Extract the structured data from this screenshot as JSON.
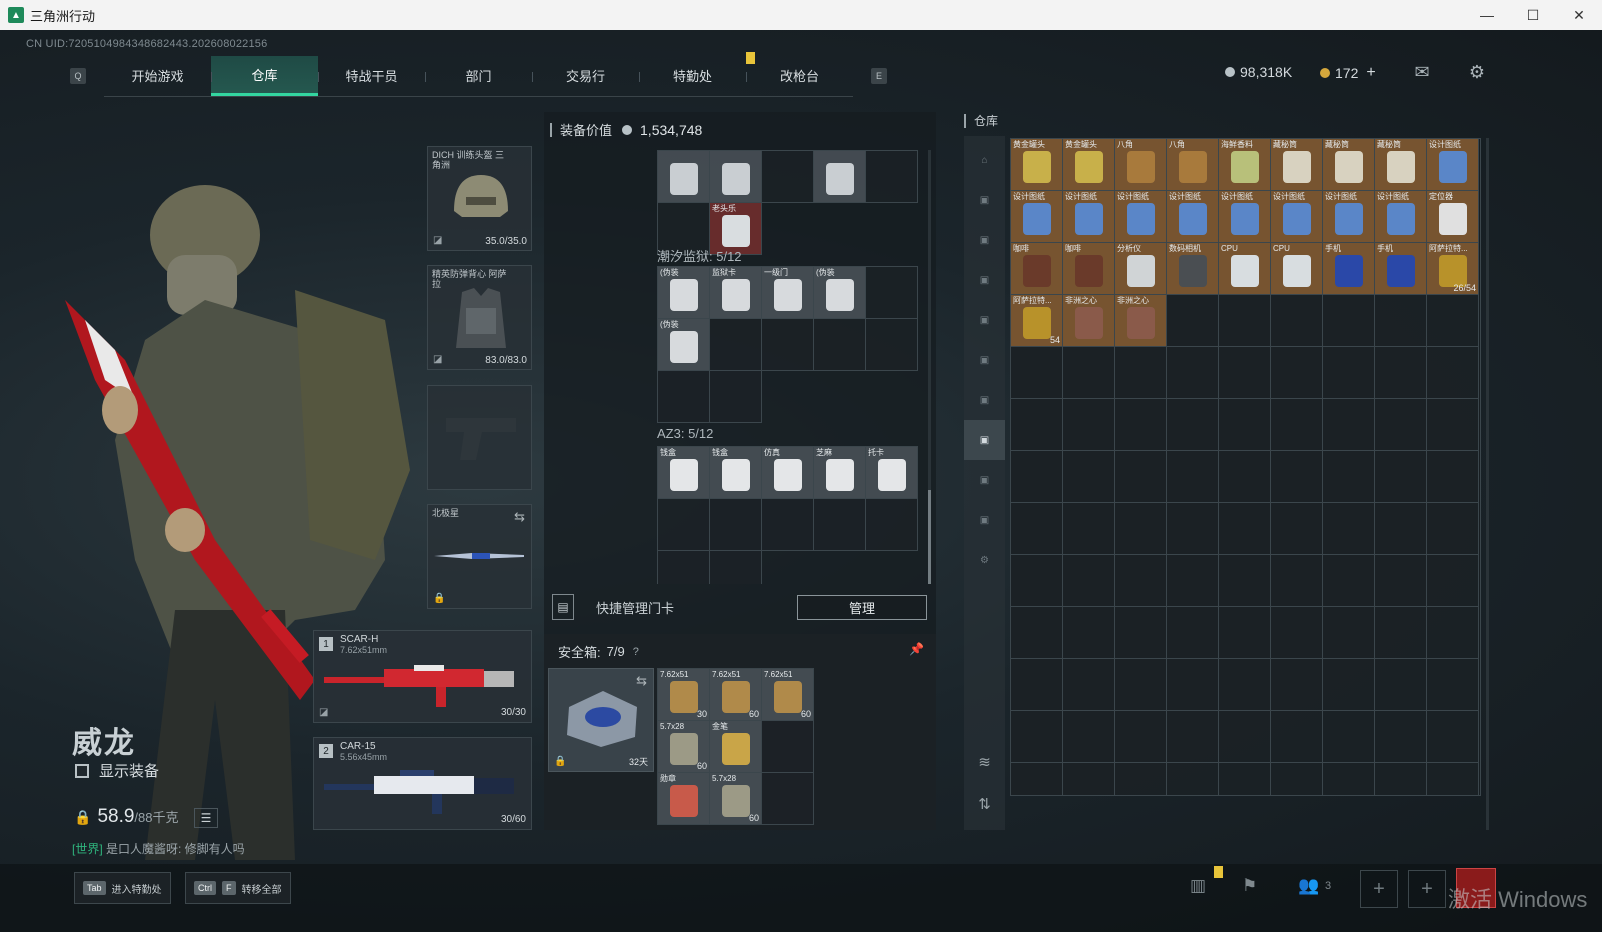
{
  "window": {
    "title": "三角洲行动",
    "minimize": "—",
    "maximize": "☐",
    "close": "✕"
  },
  "uid": "CN UID:7205104984348682443.202608022156",
  "nav": {
    "left_key": "Q",
    "right_key": "E",
    "tabs": [
      "开始游戏",
      "仓库",
      "特战干员",
      "部门",
      "交易行",
      "特勤处",
      "改枪台"
    ],
    "active_tab": "仓库"
  },
  "currency": {
    "money": "98,318K",
    "coins": "172",
    "add": "+"
  },
  "character": {
    "name": "威龙",
    "show_equipment": "显示装备",
    "weight_current": "58.9",
    "weight_max": "/88千克",
    "chat_channel": "[世界]",
    "chat_message": "是口人魔酱呀: 修脚有人吗"
  },
  "equipment": {
    "helmet": {
      "label": "DICH 训练头盔 三角洲",
      "durability": "35.0/35.0"
    },
    "armor": {
      "label": "精英防弹背心 阿萨拉",
      "durability": "83.0/83.0"
    },
    "melee": {
      "label": "北极星"
    },
    "primary": {
      "num": "1",
      "name": "SCAR-H",
      "caliber": "7.62x51mm",
      "ammo": "30/30"
    },
    "secondary": {
      "num": "2",
      "name": "CAR-15",
      "caliber": "5.56x45mm",
      "ammo": "30/60"
    }
  },
  "backpack": {
    "value_label": "装备价值",
    "value": "1,534,748",
    "top_items": [
      {
        "label": "",
        "style": "filled"
      },
      {
        "label": "",
        "style": "filled"
      },
      {
        "label": "",
        "style": "empty"
      },
      {
        "label": "",
        "style": "filled"
      },
      {
        "label": "",
        "style": "empty"
      },
      {
        "label": "",
        "style": "empty"
      },
      {
        "label": "老头乐",
        "style": "red"
      },
      {
        "label": "",
        "style": "none"
      },
      {
        "label": "",
        "style": "none"
      },
      {
        "label": "",
        "style": "none"
      }
    ],
    "section1_title": "潮汐监狱: 5/12",
    "section1_items": [
      "(伪装",
      "监狱卡",
      "一级门",
      "(伪装",
      "",
      "(伪装",
      "",
      "",
      "",
      ""
    ],
    "section2_title": "AZ3: 5/12",
    "section2_items": [
      "钱盒",
      "钱盒",
      "仿真",
      "芝麻",
      "托卡"
    ],
    "keycard_label": "快捷管理门卡",
    "manage_button": "管理"
  },
  "safe_box": {
    "title": "安全箱:",
    "capacity": "7/9",
    "help": "?",
    "days": "32天",
    "items": [
      {
        "label": "7.62x51",
        "count": "30"
      },
      {
        "label": "7.62x51",
        "count": "60"
      },
      {
        "label": "7.62x51",
        "count": "60"
      },
      {
        "label": "5.7x28",
        "count": "60"
      },
      {
        "label": "金笔",
        "count": ""
      },
      {
        "label": "",
        "count": ""
      },
      {
        "label": "勋章",
        "count": ""
      },
      {
        "label": "5.7x28",
        "count": "60"
      },
      {
        "label": "",
        "count": ""
      }
    ]
  },
  "stash": {
    "title": "仓库",
    "items": [
      {
        "label": "黄金罐头",
        "style": "orange",
        "count": ""
      },
      {
        "label": "黄金罐头",
        "style": "orange",
        "count": ""
      },
      {
        "label": "八角",
        "style": "orange",
        "count": ""
      },
      {
        "label": "八角",
        "style": "orange",
        "count": ""
      },
      {
        "label": "海鲜香料",
        "style": "orange",
        "count": ""
      },
      {
        "label": "藏秘筒",
        "style": "orange",
        "count": ""
      },
      {
        "label": "藏秘筒",
        "style": "orange",
        "count": ""
      },
      {
        "label": "藏秘筒",
        "style": "orange",
        "count": ""
      },
      {
        "label": "设计图纸",
        "style": "orange",
        "count": ""
      },
      {
        "label": "设计图纸",
        "style": "orange",
        "count": ""
      },
      {
        "label": "设计图纸",
        "style": "orange",
        "count": ""
      },
      {
        "label": "设计图纸",
        "style": "orange",
        "count": ""
      },
      {
        "label": "设计图纸",
        "style": "orange",
        "count": ""
      },
      {
        "label": "设计图纸",
        "style": "orange",
        "count": ""
      },
      {
        "label": "设计图纸",
        "style": "orange",
        "count": ""
      },
      {
        "label": "设计图纸",
        "style": "orange",
        "count": ""
      },
      {
        "label": "设计图纸",
        "style": "orange",
        "count": ""
      },
      {
        "label": "定位器",
        "style": "orange",
        "count": ""
      },
      {
        "label": "咖啡",
        "style": "orange",
        "count": ""
      },
      {
        "label": "咖啡",
        "style": "orange",
        "count": ""
      },
      {
        "label": "分析仪",
        "style": "orange",
        "count": ""
      },
      {
        "label": "数码相机",
        "style": "orange",
        "count": ""
      },
      {
        "label": "CPU",
        "style": "orange",
        "count": ""
      },
      {
        "label": "CPU",
        "style": "orange",
        "count": ""
      },
      {
        "label": "手机",
        "style": "orange",
        "count": ""
      },
      {
        "label": "手机",
        "style": "orange",
        "count": ""
      },
      {
        "label": "阿萨拉特...",
        "style": "orange",
        "count": "26/54"
      },
      {
        "label": "阿萨拉特...",
        "style": "orange",
        "count": "54"
      },
      {
        "label": "非洲之心",
        "style": "orange",
        "count": ""
      },
      {
        "label": "非洲之心",
        "style": "orange",
        "count": ""
      }
    ]
  },
  "bottom": {
    "hint1_key": "Tab",
    "hint1_label": "进入特勤处",
    "hint2_key1": "Ctrl",
    "hint2_key2": "F",
    "hint2_label": "转移全部",
    "friends_count": "3",
    "watermark": "激活 Windows"
  },
  "colors": {
    "accent": "#33d6a0",
    "tab_active": "#25584f",
    "orange_item": "#825a32",
    "red_item": "#702e2e"
  }
}
